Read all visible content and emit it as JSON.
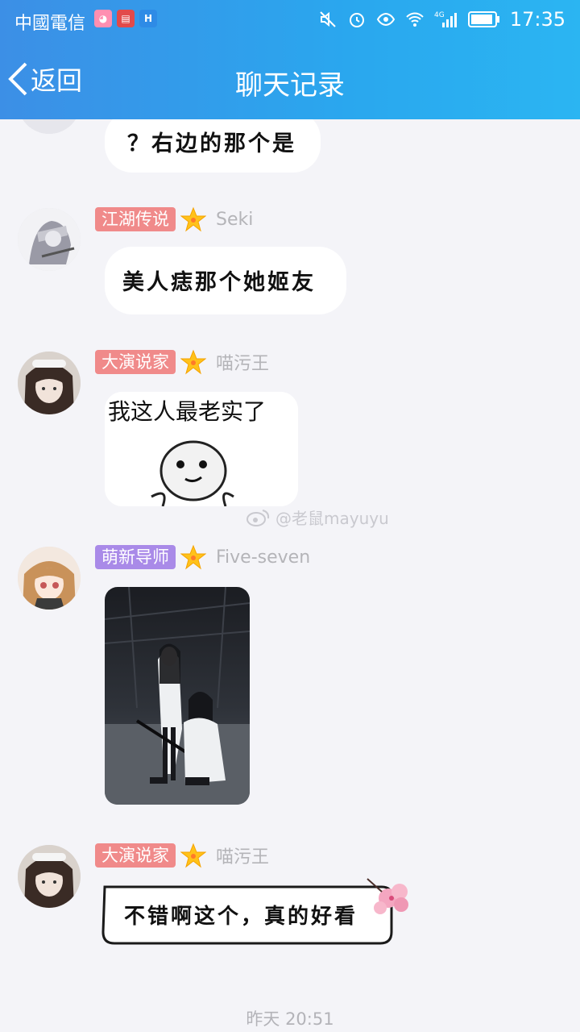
{
  "status_bar": {
    "carrier": "中國電信",
    "time": "17:35",
    "network": "4G",
    "app_icons": [
      "pink-app-icon",
      "book-app-icon",
      "hi-app-icon"
    ]
  },
  "nav": {
    "back_label": "返回",
    "title": "聊天记录"
  },
  "messages": [
    {
      "text": "？右边的那个是"
    },
    {
      "badge": "江湖传说",
      "badge_color": "#f08a8a",
      "user": "Seki",
      "text": "美人痣那个她姬友"
    },
    {
      "badge": "大演说家",
      "badge_color": "#f08a8a",
      "user": "喵污王",
      "sticker_caption": "我这人最老实了"
    },
    {
      "badge": "萌新导师",
      "badge_color": "#a98ae8",
      "user": "Five-seven",
      "image": "cosplay-photo"
    },
    {
      "badge": "大演说家",
      "badge_color": "#f08a8a",
      "user": "喵污王",
      "text": "不错啊这个，真的好看"
    }
  ],
  "watermark": "@老鼠mayuyu",
  "timestamp": "昨天 20:51"
}
